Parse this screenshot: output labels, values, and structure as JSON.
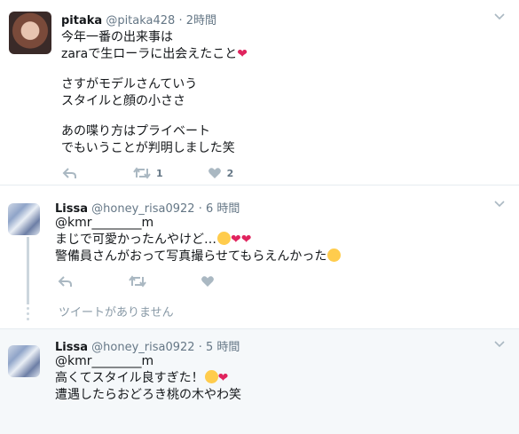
{
  "tweets": [
    {
      "name": "pitaka",
      "handle": "@pitaka428",
      "sep": "·",
      "time": "2時間",
      "lines": [
        "今年一番の出来事は",
        "zaraで生ローラに出会えたこと",
        "",
        "さすがモデルさんていう",
        "スタイルと顔の小ささ",
        "",
        "あの喋り方はプライベート",
        "でもいうことが判明しました笑"
      ],
      "retweet_count": "1",
      "like_count": "2"
    },
    {
      "name": "Lissa",
      "handle": "@honey_risa0922",
      "sep": "·",
      "time": "6 時間",
      "lines": [
        "@kmr________m",
        "まじで可愛かったんやけど…",
        "警備員さんがおって写真撮らせてもらえんかった"
      ]
    },
    {
      "name": "Lissa",
      "handle": "@honey_risa0922",
      "sep": "·",
      "time": "5 時間",
      "lines": [
        "@kmr________m",
        "高くてスタイル良すぎた！",
        "遭遇したらおどろき桃の木やわ笑"
      ]
    }
  ],
  "unavailable_text": "ツイートがありません",
  "colors": {
    "icon": "#aab8c2",
    "heart": "#e0245e",
    "meta": "#657786"
  }
}
